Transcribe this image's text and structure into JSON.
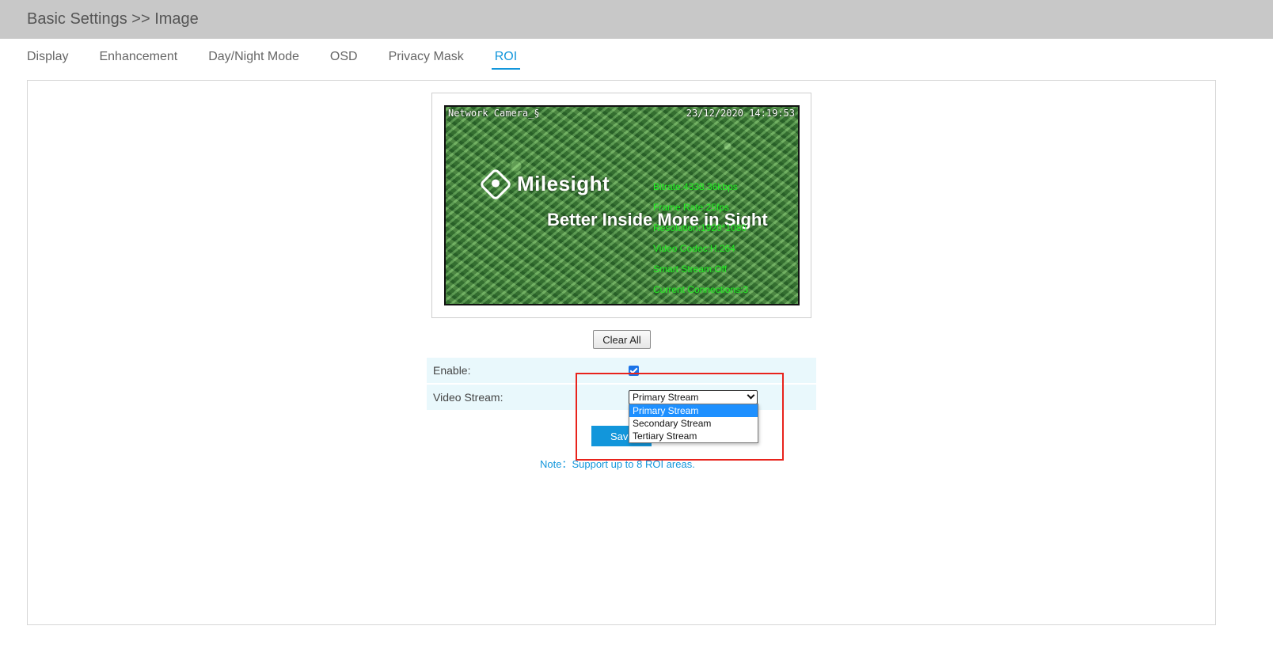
{
  "header": {
    "breadcrumb": "Basic Settings >> Image"
  },
  "tabs": [
    {
      "label": "Display",
      "active": false
    },
    {
      "label": "Enhancement",
      "active": false
    },
    {
      "label": "Day/Night Mode",
      "active": false
    },
    {
      "label": "OSD",
      "active": false
    },
    {
      "label": "Privacy Mask",
      "active": false
    },
    {
      "label": "ROI",
      "active": true
    }
  ],
  "preview": {
    "camera_name": "Network Camera_§",
    "timestamp": "23/12/2020 14:19:53",
    "logo_text": "Milesight",
    "slogan": "Better Inside More in Sight",
    "stats": [
      "Bitrate:4338.36kbps",
      "Frame Rate:25fps",
      "Resolution:1920*1080",
      "Video Codec:H.264",
      "Smart Stream:Off",
      "Current Connections:3"
    ]
  },
  "buttons": {
    "clear_all": "Clear All",
    "save": "Save"
  },
  "form": {
    "enable_label": "Enable:",
    "enable_checked": true,
    "video_stream_label": "Video Stream:",
    "video_stream_value": "Primary Stream",
    "video_stream_options": [
      "Primary Stream",
      "Secondary Stream",
      "Tertiary Stream"
    ]
  },
  "note": "Note：Support up to 8 ROI areas.",
  "colors": {
    "accent": "#1296db",
    "highlight": "#e8231c",
    "osd_green": "#22ee22",
    "row_bg": "#e9f8fc"
  }
}
